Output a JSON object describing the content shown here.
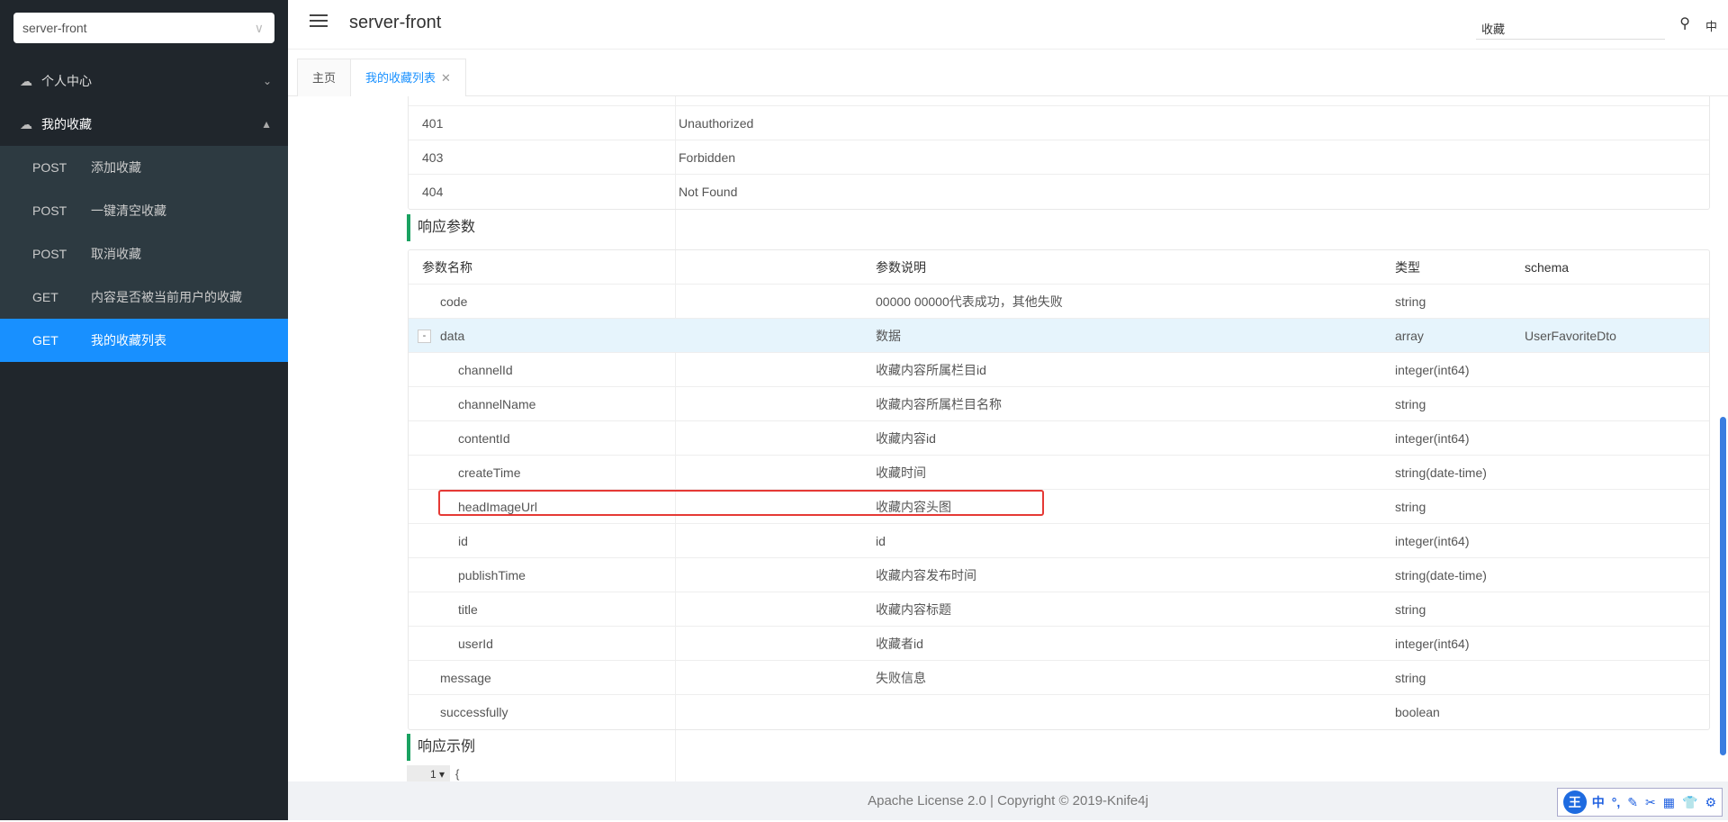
{
  "sidebar": {
    "project": "server-front",
    "groups": [
      {
        "label": "个人中心"
      },
      {
        "label": "我的收藏"
      }
    ],
    "items": [
      {
        "method": "POST",
        "label": "添加收藏"
      },
      {
        "method": "POST",
        "label": "一键清空收藏"
      },
      {
        "method": "POST",
        "label": "取消收藏"
      },
      {
        "method": "GET",
        "label": "内容是否被当前用户的收藏"
      },
      {
        "method": "GET",
        "label": "我的收藏列表"
      }
    ]
  },
  "header": {
    "title": "server-front",
    "search_value": "收藏",
    "lang": "中"
  },
  "tabs": [
    {
      "label": "主页"
    },
    {
      "label": "我的收藏列表"
    }
  ],
  "status_rows": [
    {
      "code": "401",
      "desc": "Unauthorized"
    },
    {
      "code": "403",
      "desc": "Forbidden"
    },
    {
      "code": "404",
      "desc": "Not Found"
    }
  ],
  "response": {
    "title": "响应参数",
    "headers": [
      "参数名称",
      "参数说明",
      "类型",
      "schema"
    ],
    "rows": [
      {
        "name": "code",
        "desc": "00000 00000代表成功，其他失败",
        "type": "string",
        "schema": ""
      },
      {
        "name": "data",
        "desc": "数据",
        "type": "array",
        "schema": "UserFavoriteDto",
        "toggle": "-"
      },
      {
        "name": "channelId",
        "desc": "收藏内容所属栏目id",
        "type": "integer(int64)",
        "schema": ""
      },
      {
        "name": "channelName",
        "desc": "收藏内容所属栏目名称",
        "type": "string",
        "schema": ""
      },
      {
        "name": "contentId",
        "desc": "收藏内容id",
        "type": "integer(int64)",
        "schema": ""
      },
      {
        "name": "createTime",
        "desc": "收藏时间",
        "type": "string(date-time)",
        "schema": ""
      },
      {
        "name": "headImageUrl",
        "desc": "收藏内容头图",
        "type": "string",
        "schema": ""
      },
      {
        "name": "id",
        "desc": "id",
        "type": "integer(int64)",
        "schema": ""
      },
      {
        "name": "publishTime",
        "desc": "收藏内容发布时间",
        "type": "string(date-time)",
        "schema": ""
      },
      {
        "name": "title",
        "desc": "收藏内容标题",
        "type": "string",
        "schema": ""
      },
      {
        "name": "userId",
        "desc": "收藏者id",
        "type": "integer(int64)",
        "schema": ""
      },
      {
        "name": "message",
        "desc": "失败信息",
        "type": "string",
        "schema": ""
      },
      {
        "name": "successfully",
        "desc": "",
        "type": "boolean",
        "schema": ""
      }
    ]
  },
  "example": {
    "title": "响应示例",
    "line": "1",
    "text": "{"
  },
  "footer": {
    "text": "Apache License 2.0 | Copyright © 2019-Knife4j"
  },
  "ime": {
    "logo": "王",
    "items": [
      "中",
      "°,",
      "✎",
      "✂",
      "▦",
      "👕",
      "⚙"
    ]
  }
}
